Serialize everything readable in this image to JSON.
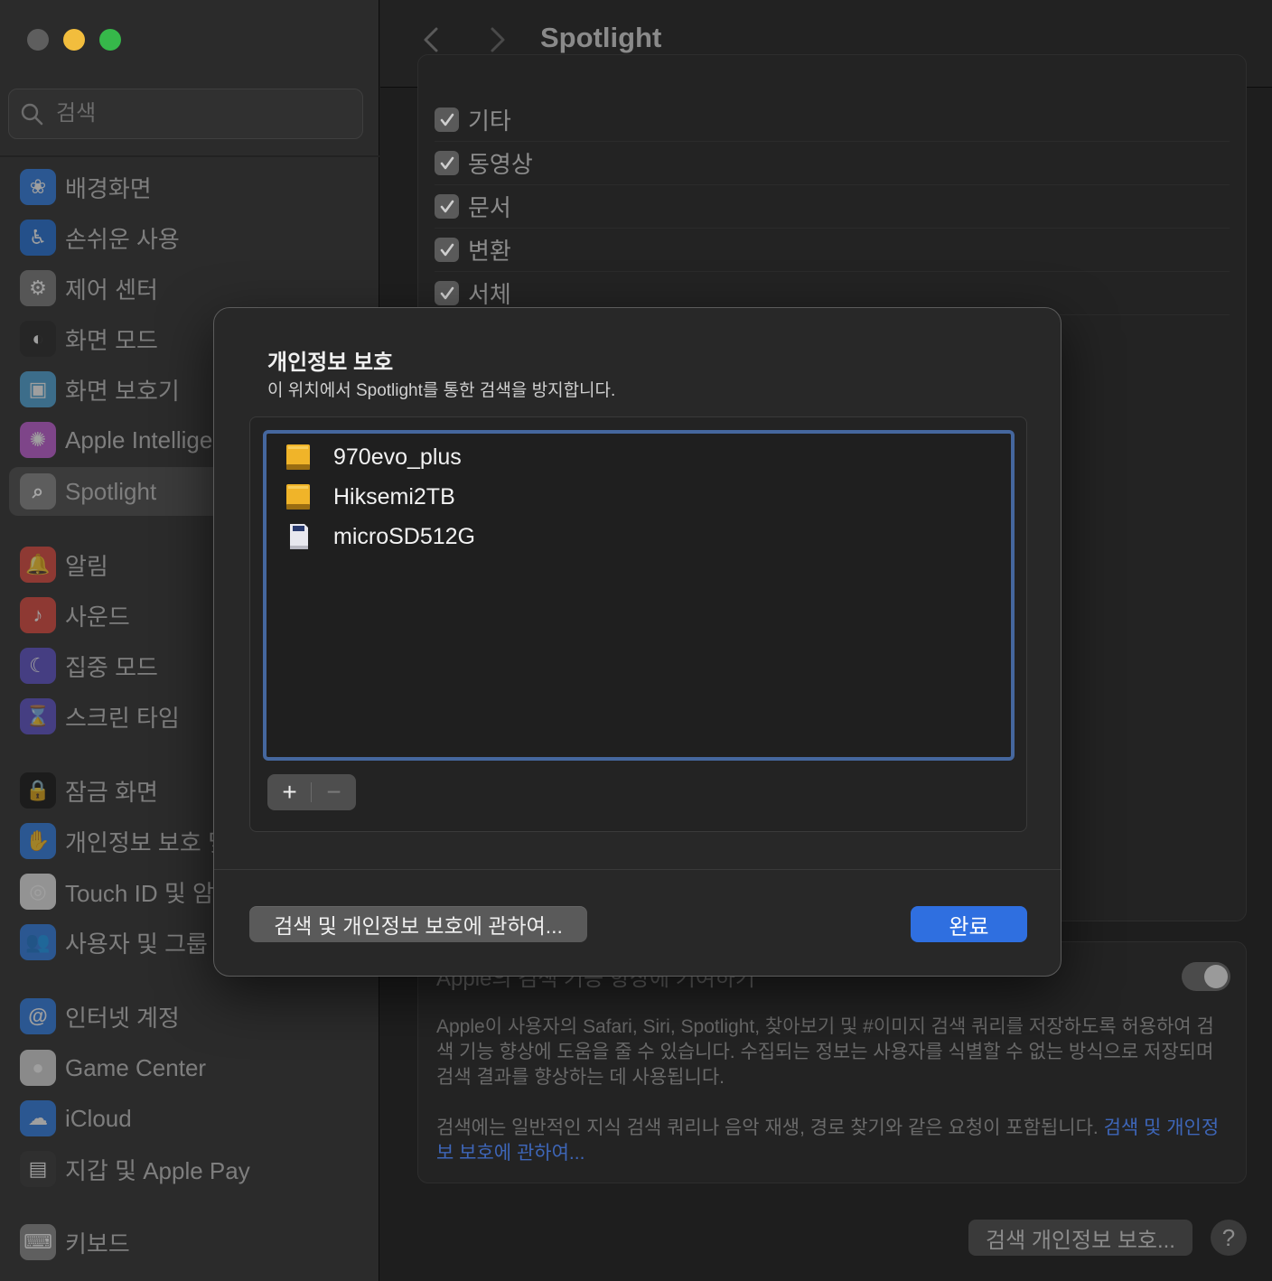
{
  "window": {
    "title": "Spotlight"
  },
  "search": {
    "placeholder": "검색"
  },
  "sidebar": {
    "items": [
      {
        "label": "배경화면",
        "icon": "wallpaper-icon",
        "color": "#2c7be5",
        "glyph": "❀"
      },
      {
        "label": "손쉬운 사용",
        "icon": "accessibility-icon",
        "color": "#1f6fd8",
        "glyph": "♿"
      },
      {
        "label": "제어 센터",
        "icon": "control-center-icon",
        "color": "#7a7a7a",
        "glyph": "⚙"
      },
      {
        "label": "화면 모드",
        "icon": "appearance-icon",
        "color": "#222222",
        "glyph": "◐"
      },
      {
        "label": "화면 보호기",
        "icon": "screensaver-icon",
        "color": "#4aa3d8",
        "glyph": "▣"
      },
      {
        "label": "Apple Intelligence & Siri",
        "icon": "apple-intelligence-icon",
        "color": "#c25bd6",
        "glyph": "✺"
      },
      {
        "label": "Spotlight",
        "icon": "spotlight-icon",
        "color": "#7a7a7a",
        "glyph": "⌕",
        "active": true
      },
      {
        "label": "알림",
        "icon": "notifications-icon",
        "color": "#e0453b",
        "glyph": "🔔"
      },
      {
        "label": "사운드",
        "icon": "sound-icon",
        "color": "#e0453b",
        "glyph": "♪"
      },
      {
        "label": "집중 모드",
        "icon": "focus-icon",
        "color": "#5b4fc9",
        "glyph": "☾"
      },
      {
        "label": "스크린 타임",
        "icon": "screen-time-icon",
        "color": "#5b4fc9",
        "glyph": "⌛"
      },
      {
        "label": "잠금 화면",
        "icon": "lock-screen-icon",
        "color": "#111111",
        "glyph": "🔒"
      },
      {
        "label": "개인정보 보호 및 보안",
        "icon": "privacy-hand-icon",
        "color": "#2c7be5",
        "glyph": "✋"
      },
      {
        "label": "Touch ID 및 암호",
        "icon": "touch-id-icon",
        "color": "#e9e9e9",
        "glyph": "◎"
      },
      {
        "label": "사용자 및 그룹",
        "icon": "users-icon",
        "color": "#2c7be5",
        "glyph": "👥"
      },
      {
        "label": "인터넷 계정",
        "icon": "internet-accounts-icon",
        "color": "#2c7be5",
        "glyph": "@"
      },
      {
        "label": "Game Center",
        "icon": "game-center-icon",
        "color": "#d9d9d9",
        "glyph": "●"
      },
      {
        "label": "iCloud",
        "icon": "icloud-icon",
        "color": "#2c7be5",
        "glyph": "☁"
      },
      {
        "label": "지갑 및 Apple Pay",
        "icon": "wallet-icon",
        "color": "#333333",
        "glyph": "▤"
      },
      {
        "label": "키보드",
        "icon": "keyboard-icon",
        "color": "#8a8a8a",
        "glyph": "⌨"
      }
    ]
  },
  "categories": [
    {
      "label": "기타",
      "checked": true
    },
    {
      "label": "동영상",
      "checked": true
    },
    {
      "label": "문서",
      "checked": true
    },
    {
      "label": "변환",
      "checked": true
    },
    {
      "label": "서체",
      "checked": true
    }
  ],
  "info": {
    "title": "Apple의 검색 기능 향상에 기여하기",
    "para1": "Apple이 사용자의 Safari, Siri, Spotlight, 찾아보기 및 #이미지 검색 쿼리를 저장하도록 허용하여 검색 기능 향상에 도움을 줄 수 있습니다. 수집되는 정보는 사용자를 식별할 수 없는 방식으로 저장되며 검색 결과를 향상하는 데 사용됩니다.",
    "para2": "검색에는 일반적인 지식 검색 쿼리나 음악 재생, 경로 찾기와 같은 요청이 포함됩니다.",
    "link": "검색 및 개인정보 보호에 관하여..."
  },
  "footer": {
    "privacy_button": "검색 개인정보 보호...",
    "help": "?"
  },
  "sheet": {
    "title": "개인정보 보호",
    "subtitle": "이 위치에서 Spotlight를 통한 검색을 방지합니다.",
    "volumes": [
      {
        "name": "970evo_plus",
        "icon": "external-drive-icon"
      },
      {
        "name": "Hiksemi2TB",
        "icon": "external-drive-icon"
      },
      {
        "name": "microSD512G",
        "icon": "sd-card-icon"
      }
    ],
    "add_label": "+",
    "remove_label": "−",
    "about_button": "검색 및 개인정보 보호에 관하여...",
    "done_button": "완료"
  },
  "colors": {
    "accent": "#2f6fe0",
    "list_focus": "#45679e",
    "drive": "#f0b429"
  }
}
